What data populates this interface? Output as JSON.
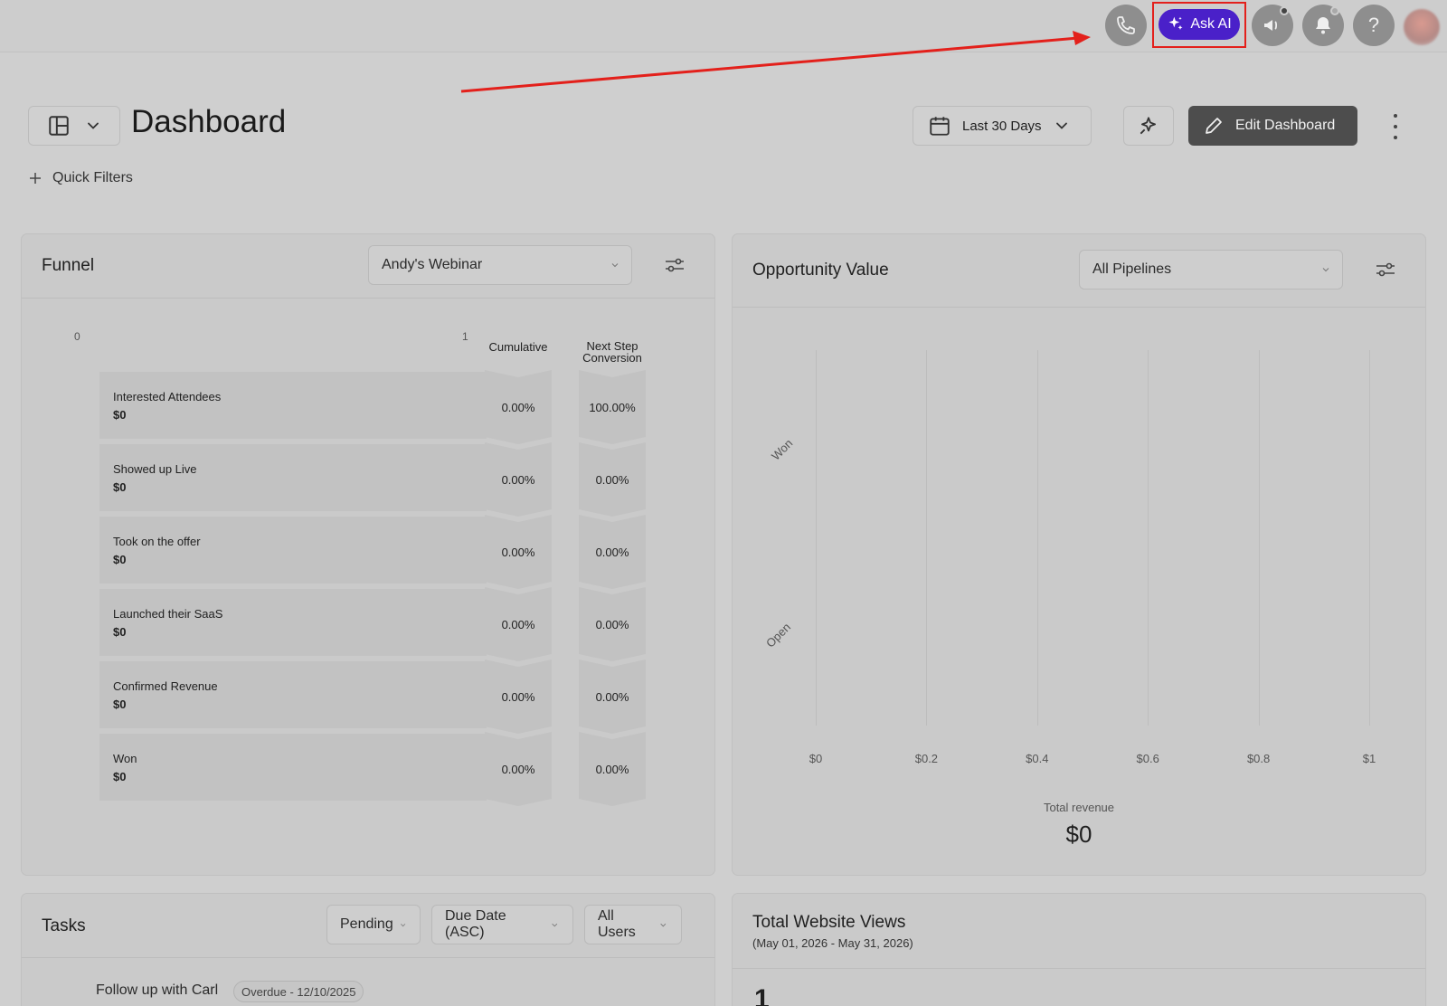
{
  "topbar": {
    "ask_ai_label": "Ask AI",
    "help_label": "?",
    "accent_color": "#4a20c9",
    "highlight_color": "#e3201b"
  },
  "header": {
    "title": "Dashboard",
    "quick_filters_label": "Quick Filters",
    "date_range_label": "Last 30 Days",
    "edit_dashboard_label": "Edit Dashboard"
  },
  "funnel": {
    "title": "Funnel",
    "selected_funnel": "Andy's Webinar",
    "axis_min": "0",
    "axis_max": "1",
    "cumulative_header": "Cumulative",
    "next_step_header_line1": "Next Step",
    "next_step_header_line2": "Conversion",
    "stages": [
      {
        "name": "Interested Attendees",
        "value": "$0",
        "cumulative": "0.00%",
        "next_step": "100.00%"
      },
      {
        "name": "Showed up Live",
        "value": "$0",
        "cumulative": "0.00%",
        "next_step": "0.00%"
      },
      {
        "name": "Took on the offer",
        "value": "$0",
        "cumulative": "0.00%",
        "next_step": "0.00%"
      },
      {
        "name": "Launched their SaaS",
        "value": "$0",
        "cumulative": "0.00%",
        "next_step": "0.00%"
      },
      {
        "name": "Confirmed Revenue",
        "value": "$0",
        "cumulative": "0.00%",
        "next_step": "0.00%"
      },
      {
        "name": "Won",
        "value": "$0",
        "cumulative": "0.00%",
        "next_step": "0.00%"
      }
    ]
  },
  "opportunity": {
    "title": "Opportunity Value",
    "selected_pipeline": "All Pipelines",
    "total_revenue_label": "Total revenue",
    "total_revenue_value": "$0"
  },
  "chart_data": {
    "type": "bar",
    "orientation": "horizontal",
    "categories": [
      "Won",
      "Open"
    ],
    "values": [
      0,
      0
    ],
    "x_ticks": [
      "$0",
      "$0.2",
      "$0.4",
      "$0.6",
      "$0.8",
      "$1"
    ],
    "xlim": [
      0,
      1
    ],
    "grid": true
  },
  "tasks": {
    "title": "Tasks",
    "status_filter": "Pending",
    "sort_filter": "Due Date (ASC)",
    "user_filter": "All Users",
    "items": [
      {
        "title": "Follow up with Carl",
        "badge": "Overdue - 12/10/2025"
      }
    ]
  },
  "website_views": {
    "title": "Total Website Views",
    "date_range": "(May 01, 2026 - May 31, 2026)",
    "value": "1"
  }
}
